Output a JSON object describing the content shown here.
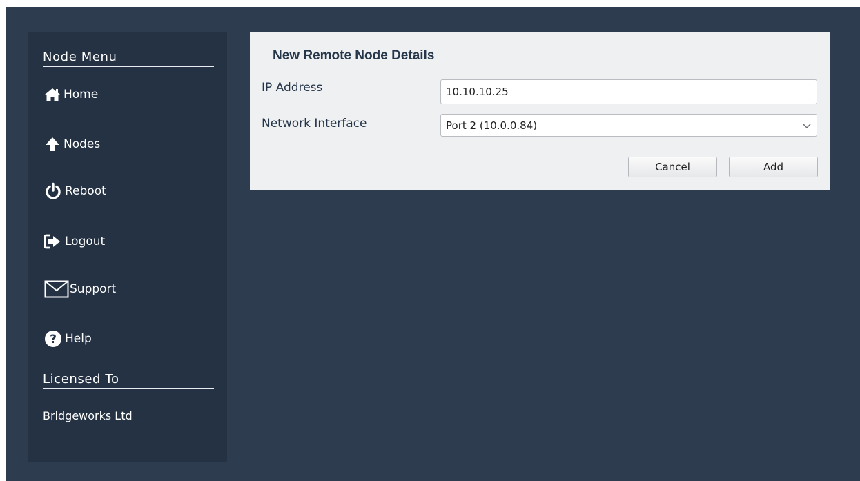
{
  "sidebar": {
    "menu_title": "Node Menu",
    "items": [
      {
        "label": "Home",
        "icon": "home-icon"
      },
      {
        "label": "Nodes",
        "icon": "arrow-up-icon"
      },
      {
        "label": "Reboot",
        "icon": "power-icon"
      },
      {
        "label": "Logout",
        "icon": "logout-icon"
      },
      {
        "label": "Support",
        "icon": "envelope-icon"
      },
      {
        "label": "Help",
        "icon": "question-icon"
      }
    ],
    "license_title": "Licensed To",
    "licensee": "Bridgeworks Ltd"
  },
  "form": {
    "title": "New Remote Node Details",
    "ip_label": "IP Address",
    "ip_value": "10.10.10.25",
    "interface_label": "Network Interface",
    "interface_value": "Port 2 (10.0.0.84)",
    "cancel_label": "Cancel",
    "add_label": "Add"
  },
  "colors": {
    "background": "#2e3c50",
    "sidebar": "#243244",
    "panel": "#eef0f1",
    "text_dark": "#26364a"
  }
}
